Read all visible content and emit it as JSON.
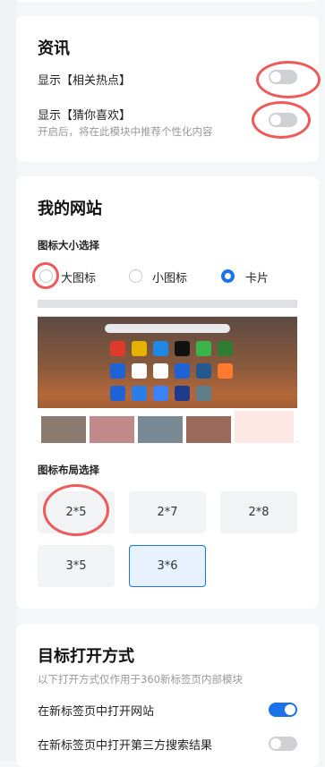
{
  "news": {
    "title": "资讯",
    "show_hot_label": "显示【相关热点】",
    "show_hot_on": false,
    "show_guess_label": "显示【猜你喜欢】",
    "show_guess_on": false,
    "show_guess_desc": "开启后，将在此模块中推荐个性化内容"
  },
  "sites": {
    "title": "我的网站",
    "icon_size_label": "图标大小选择",
    "size_options": [
      {
        "label": "大图标",
        "selected": false
      },
      {
        "label": "小图标",
        "selected": false
      },
      {
        "label": "卡片",
        "selected": true
      }
    ],
    "layout_label": "图标布局选择",
    "layout_options": [
      {
        "label": "2*5",
        "selected": false
      },
      {
        "label": "2*7",
        "selected": false
      },
      {
        "label": "2*8",
        "selected": false
      },
      {
        "label": "3*5",
        "selected": false
      },
      {
        "label": "3*6",
        "selected": true
      }
    ]
  },
  "open": {
    "title": "目标打开方式",
    "desc": "以下打开方式仅作用于360新标签页内部模块",
    "new_tab_site_label": "在新标签页中打开网站",
    "new_tab_site_on": true,
    "new_tab_search_label": "在新标签页中打开第三方搜索结果",
    "new_tab_search_on": false
  },
  "colors": {
    "accent": "#1a73e8",
    "annotation": "#ee5a5a",
    "toggle_off": "#cfd0d3"
  }
}
